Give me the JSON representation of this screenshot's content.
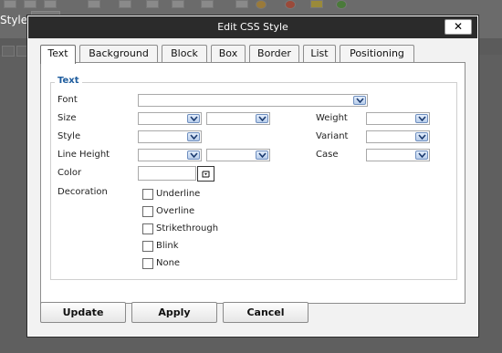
{
  "background": {
    "style_label": "Style"
  },
  "dialog": {
    "title": "Edit CSS Style",
    "close_label": "✕",
    "tabs": [
      {
        "label": "Text",
        "active": true
      },
      {
        "label": "Background"
      },
      {
        "label": "Block"
      },
      {
        "label": "Box"
      },
      {
        "label": "Border"
      },
      {
        "label": "List"
      },
      {
        "label": "Positioning"
      }
    ],
    "section_title": "Text",
    "fields": {
      "font": {
        "label": "Font",
        "value": ""
      },
      "size": {
        "label": "Size",
        "value": "",
        "unit": ""
      },
      "weight": {
        "label": "Weight",
        "value": ""
      },
      "style": {
        "label": "Style",
        "value": ""
      },
      "variant": {
        "label": "Variant",
        "value": ""
      },
      "line_height": {
        "label": "Line Height",
        "value": "",
        "unit": ""
      },
      "case": {
        "label": "Case",
        "value": ""
      },
      "color": {
        "label": "Color",
        "value": ""
      },
      "decoration": {
        "label": "Decoration",
        "options": [
          {
            "label": "Underline",
            "checked": false
          },
          {
            "label": "Overline",
            "checked": false
          },
          {
            "label": "Strikethrough",
            "checked": false
          },
          {
            "label": "Blink",
            "checked": false
          },
          {
            "label": "None",
            "checked": false
          }
        ]
      }
    },
    "buttons": {
      "update": "Update",
      "apply": "Apply",
      "cancel": "Cancel"
    }
  }
}
